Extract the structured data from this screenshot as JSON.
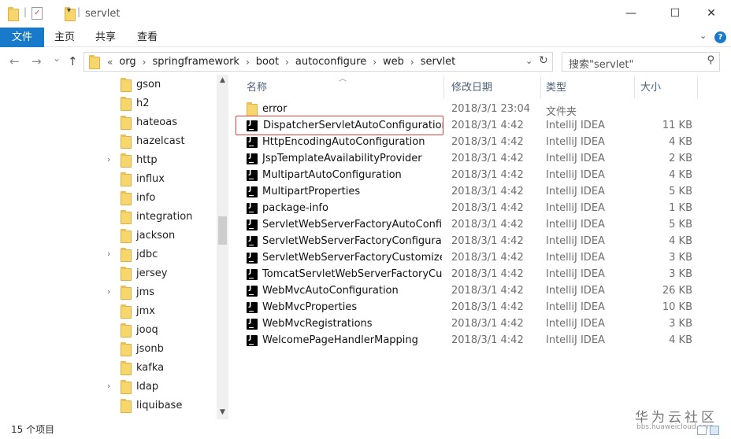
{
  "window": {
    "title": "servlet",
    "minimize": "—",
    "maximize": "☐",
    "close": "✕"
  },
  "ribbon": {
    "tabs": [
      "文件",
      "主页",
      "共享",
      "查看"
    ]
  },
  "address": {
    "back": "←",
    "forward": "→",
    "recent": "⌄",
    "up": "↑",
    "overflow": "«",
    "path": [
      "org",
      "springframework",
      "boot",
      "autoconfigure",
      "web",
      "servlet"
    ],
    "refresh": "↻",
    "search_placeholder": "搜索\"servlet\""
  },
  "nav_pane": {
    "items": [
      {
        "label": "gson",
        "expandable": false
      },
      {
        "label": "h2",
        "expandable": false
      },
      {
        "label": "hateoas",
        "expandable": false
      },
      {
        "label": "hazelcast",
        "expandable": false
      },
      {
        "label": "http",
        "expandable": true
      },
      {
        "label": "influx",
        "expandable": false
      },
      {
        "label": "info",
        "expandable": false
      },
      {
        "label": "integration",
        "expandable": false
      },
      {
        "label": "jackson",
        "expandable": false
      },
      {
        "label": "jdbc",
        "expandable": true
      },
      {
        "label": "jersey",
        "expandable": false
      },
      {
        "label": "jms",
        "expandable": true
      },
      {
        "label": "jmx",
        "expandable": false
      },
      {
        "label": "jooq",
        "expandable": false
      },
      {
        "label": "jsonb",
        "expandable": false
      },
      {
        "label": "kafka",
        "expandable": false
      },
      {
        "label": "ldap",
        "expandable": true
      },
      {
        "label": "liquibase",
        "expandable": false
      }
    ]
  },
  "columns": {
    "name": "名称",
    "date": "修改日期",
    "type": "类型",
    "size": "大小"
  },
  "files": [
    {
      "name": "error",
      "date": "2018/3/1 23:04",
      "type": "文件夹",
      "size": "",
      "kind": "folder"
    },
    {
      "name": "DispatcherServletAutoConfiguration",
      "date": "2018/3/1 4:42",
      "type": "IntelliJ IDEA",
      "size": "11 KB",
      "kind": "idea",
      "highlighted": true
    },
    {
      "name": "HttpEncodingAutoConfiguration",
      "date": "2018/3/1 4:42",
      "type": "IntelliJ IDEA",
      "size": "4 KB",
      "kind": "idea"
    },
    {
      "name": "JspTemplateAvailabilityProvider",
      "date": "2018/3/1 4:42",
      "type": "IntelliJ IDEA",
      "size": "2 KB",
      "kind": "idea"
    },
    {
      "name": "MultipartAutoConfiguration",
      "date": "2018/3/1 4:42",
      "type": "IntelliJ IDEA",
      "size": "4 KB",
      "kind": "idea"
    },
    {
      "name": "MultipartProperties",
      "date": "2018/3/1 4:42",
      "type": "IntelliJ IDEA",
      "size": "5 KB",
      "kind": "idea"
    },
    {
      "name": "package-info",
      "date": "2018/3/1 4:42",
      "type": "IntelliJ IDEA",
      "size": "1 KB",
      "kind": "idea"
    },
    {
      "name": "ServletWebServerFactoryAutoConfigu...",
      "date": "2018/3/1 4:42",
      "type": "IntelliJ IDEA",
      "size": "5 KB",
      "kind": "idea"
    },
    {
      "name": "ServletWebServerFactoryConfiguration",
      "date": "2018/3/1 4:42",
      "type": "IntelliJ IDEA",
      "size": "4 KB",
      "kind": "idea"
    },
    {
      "name": "ServletWebServerFactoryCustomizer",
      "date": "2018/3/1 4:42",
      "type": "IntelliJ IDEA",
      "size": "3 KB",
      "kind": "idea"
    },
    {
      "name": "TomcatServletWebServerFactoryCust...",
      "date": "2018/3/1 4:42",
      "type": "IntelliJ IDEA",
      "size": "3 KB",
      "kind": "idea"
    },
    {
      "name": "WebMvcAutoConfiguration",
      "date": "2018/3/1 4:42",
      "type": "IntelliJ IDEA",
      "size": "26 KB",
      "kind": "idea"
    },
    {
      "name": "WebMvcProperties",
      "date": "2018/3/1 4:42",
      "type": "IntelliJ IDEA",
      "size": "10 KB",
      "kind": "idea"
    },
    {
      "name": "WebMvcRegistrations",
      "date": "2018/3/1 4:42",
      "type": "IntelliJ IDEA",
      "size": "3 KB",
      "kind": "idea"
    },
    {
      "name": "WelcomePageHandlerMapping",
      "date": "2018/3/1 4:42",
      "type": "IntelliJ IDEA",
      "size": "4 KB",
      "kind": "idea"
    }
  ],
  "status": {
    "item_count": "15 个项目"
  },
  "watermark": {
    "brand": "华为云社区",
    "url": "bbs.huaweicloud.com"
  },
  "colors": {
    "accent": "#1979ca",
    "highlight_border": "#d9453c",
    "folder": "#f6d66d"
  }
}
